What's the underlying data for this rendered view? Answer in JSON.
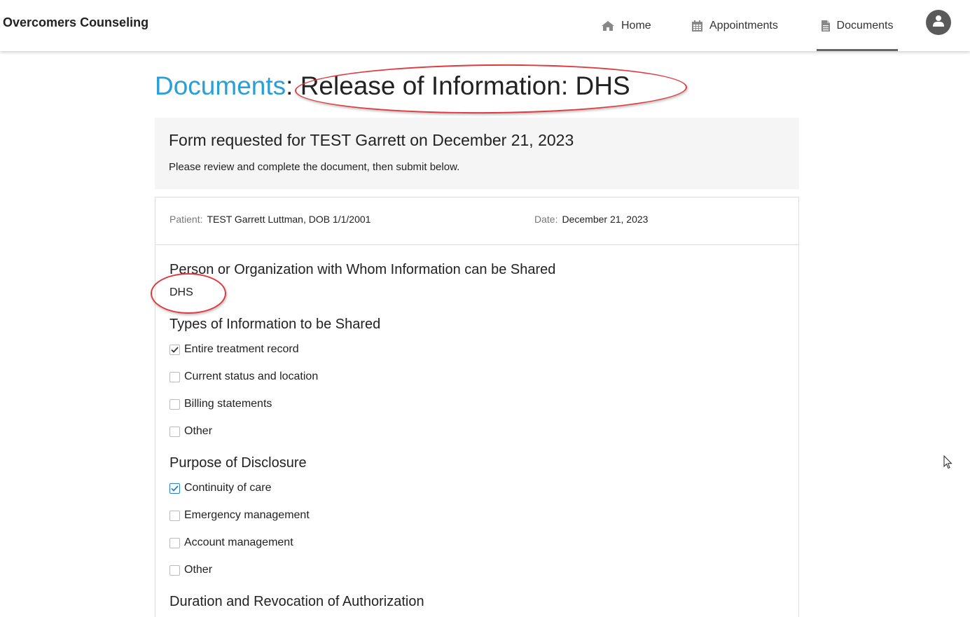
{
  "navbar": {
    "brand": "Overcomers Counseling",
    "items": [
      {
        "label": "Home",
        "icon": "home-icon"
      },
      {
        "label": "Appointments",
        "icon": "calendar-icon"
      },
      {
        "label": "Documents",
        "icon": "document-icon",
        "active": true
      }
    ],
    "avatar_icon": "user-icon"
  },
  "page": {
    "breadcrumb": "Documents",
    "separator": ":",
    "title": "Release of Information: DHS"
  },
  "request": {
    "heading": "Form requested for TEST Garrett on December 21, 2023",
    "instructions": "Please review and complete the document, then submit below."
  },
  "document": {
    "patient_label": "Patient:",
    "patient_value": "TEST Garrett Luttman, DOB 1/1/2001",
    "date_label": "Date:",
    "date_value": "December 21, 2023",
    "recipient_title": "Person or Organization with Whom Information can be Shared",
    "recipient_value": "DHS",
    "info_types_title": "Types of Information to be Shared",
    "info_types": [
      {
        "label": "Entire treatment record",
        "checked": true
      },
      {
        "label": "Current status and location",
        "checked": false
      },
      {
        "label": "Billing statements",
        "checked": false
      },
      {
        "label": "Other",
        "checked": false
      }
    ],
    "purpose_title": "Purpose of Disclosure",
    "purposes": [
      {
        "label": "Continuity of care",
        "checked": true
      },
      {
        "label": "Emergency management",
        "checked": false
      },
      {
        "label": "Account management",
        "checked": false
      },
      {
        "label": "Other",
        "checked": false
      }
    ],
    "duration_title": "Duration and Revocation of Authorization"
  },
  "colors": {
    "accent": "#2a9fd6",
    "annotation": "#e0393e",
    "active_tab_underline": "#666666"
  }
}
